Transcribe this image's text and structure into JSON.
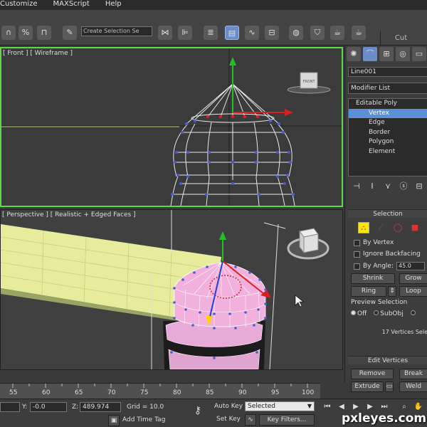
{
  "menu": [
    "Customize",
    "MAXScript",
    "Help"
  ],
  "toolbar": {
    "selection_set_placeholder": "Create Selection Se",
    "cut_label": "Cut"
  },
  "viewports": {
    "front": {
      "label": "[ Front ] [ Wireframe ]",
      "cube_label": "FRONT"
    },
    "perspective": {
      "label": "[ Perspective ] [ Realistic + Edged Faces ]"
    }
  },
  "command_panel": {
    "object_name": "Line001",
    "modifier_list": "Modifier List",
    "stack": [
      {
        "label": "Editable Poly",
        "root": true
      },
      {
        "label": "Vertex",
        "selected": true
      },
      {
        "label": "Edge"
      },
      {
        "label": "Border"
      },
      {
        "label": "Polygon"
      },
      {
        "label": "Element"
      }
    ],
    "selection": {
      "title": "Selection",
      "by_vertex": "By Vertex",
      "ignore_backfacing": "Ignore Backfacing",
      "by_angle": "By Angle:",
      "angle_value": "45.0",
      "shrink": "Shrink",
      "grow": "Grow",
      "ring": "Ring",
      "loop": "Loop",
      "preview_title": "Preview Selection",
      "preview_off": "Off",
      "preview_subobj": "SubObj",
      "count": "17 Vertices Sele"
    },
    "edit_vertices": {
      "title": "Edit Vertices",
      "remove": "Remove",
      "break": "Break",
      "extrude": "Extrude",
      "weld": "Weld"
    }
  },
  "timeline": {
    "ticks": [
      "55",
      "60",
      "65",
      "70",
      "75",
      "80",
      "85",
      "90",
      "95",
      "100"
    ]
  },
  "status": {
    "x_value": "",
    "y_label": "Y:",
    "y_value": "-0.0",
    "z_label": "Z:",
    "z_value": "489.974",
    "grid": "Grid = 10.0",
    "add_time_tag": "Add Time Tag",
    "auto_key": "Auto Key",
    "set_key": "Set Key",
    "key_mode": "Selected",
    "key_filters": "Key Filters..."
  },
  "watermark": "pxleyes.com",
  "colors": {
    "viewport_active_border": "#5fd84a",
    "selection_highlight": "#5b8fd6",
    "selected_polys": "#f2a8d8"
  }
}
